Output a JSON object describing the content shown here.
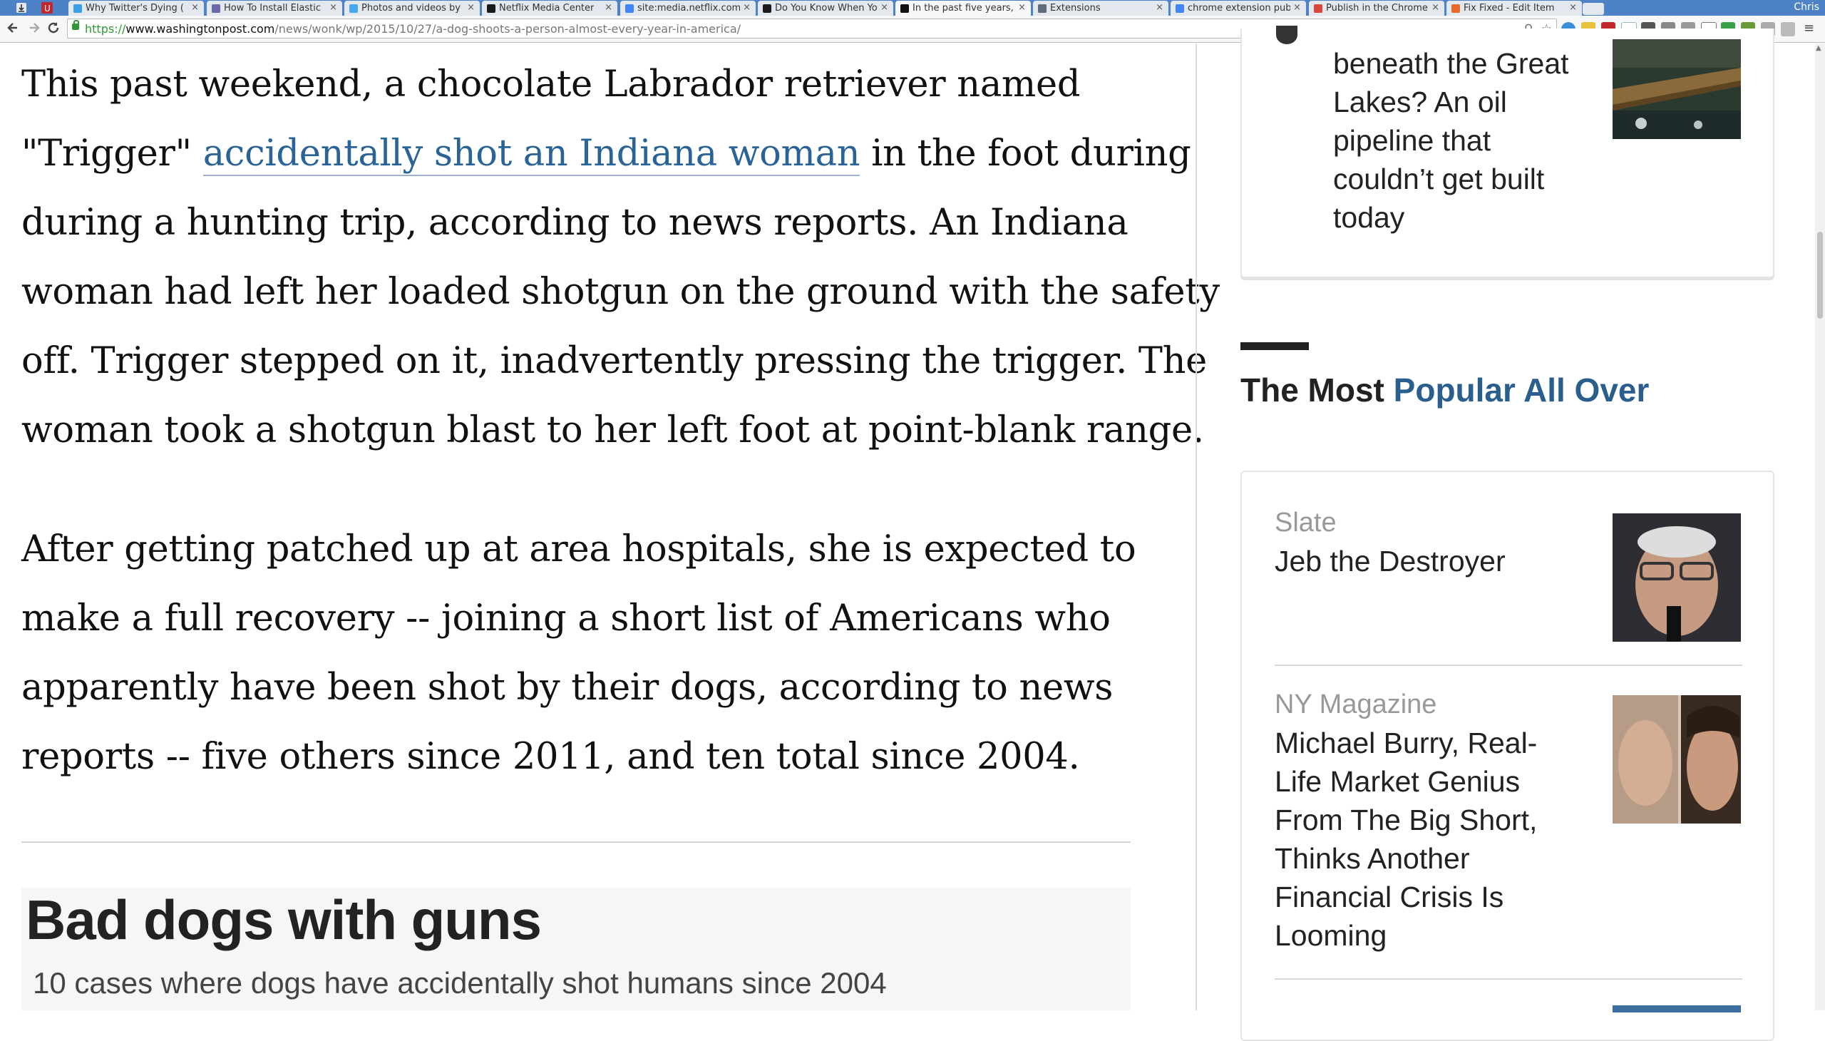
{
  "browser": {
    "tabs": [
      {
        "title": "Why Twitter's Dying (",
        "fav": "#3aa1e8"
      },
      {
        "title": "How To Install Elastic",
        "fav": "#6a6aa8"
      },
      {
        "title": "Photos and videos by",
        "fav": "#4aa9ec"
      },
      {
        "title": "Netflix Media Center",
        "fav": "#1b1b1b"
      },
      {
        "title": "site:media.netflix.com",
        "fav": "#4285f4"
      },
      {
        "title": "Do You Know When Yo",
        "fav": "#1b1b1b"
      },
      {
        "title": "In the past five years,",
        "fav": "#111111"
      },
      {
        "title": "Extensions",
        "fav": "#5f6a7a"
      },
      {
        "title": "chrome extension pub",
        "fav": "#4285f4"
      },
      {
        "title": "Publish in the Chrome",
        "fav": "#d9483b"
      },
      {
        "title": "Fix Fixed - Edit Item",
        "fav": "#e56a2b"
      }
    ],
    "user": "Chris",
    "url_scheme": "https://",
    "url_host": "www.washingtonpost.com",
    "url_path": "/news/wonk/wp/2015/10/27/a-dog-shoots-a-person-almost-every-year-in-america/",
    "close_glyph": "×"
  },
  "article": {
    "para1_before": "This past weekend, a chocolate Labrador retriever named",
    "para1_quote": "\"Trigger\" ",
    "para1_link": "accidentally shot an Indiana woman",
    "para1_after": " in the foot during",
    "para1_l3": "during a hunting trip, according to news reports. An Indiana",
    "para1_l4": "woman had left her loaded shotgun on the ground with the safety",
    "para1_l5": "off. Trigger stepped on it, inadvertently pressing the trigger. The",
    "para1_l6": "woman took a shotgun blast to her left foot at point-blank range.",
    "para2_l1": "After getting patched up at area hospitals, she is expected to",
    "para2_l2": "make a full recovery -- joining a short list of Americans who",
    "para2_l3": "apparently have been shot by their dogs, according to news",
    "para2_l4": "reports -- five others since 2011, and ten total since 2004.",
    "graphic_title": "Bad dogs with guns",
    "graphic_subtitle": "10 cases where dogs have accidentally shot humans since 2004"
  },
  "sidebar": {
    "top_story_lines": [
      "beneath the Great",
      "Lakes? An oil",
      "pipeline that",
      "couldn’t get built",
      "today"
    ],
    "section_prefix": "The Most ",
    "section_highlight": "Popular All Over",
    "items": [
      {
        "source": "Slate",
        "title": "Jeb the Destroyer"
      },
      {
        "source": "NY Magazine",
        "title": "Michael Burry, Real-Life Market Genius From The Big Short, Thinks Another Financial Crisis Is Looming"
      }
    ]
  }
}
